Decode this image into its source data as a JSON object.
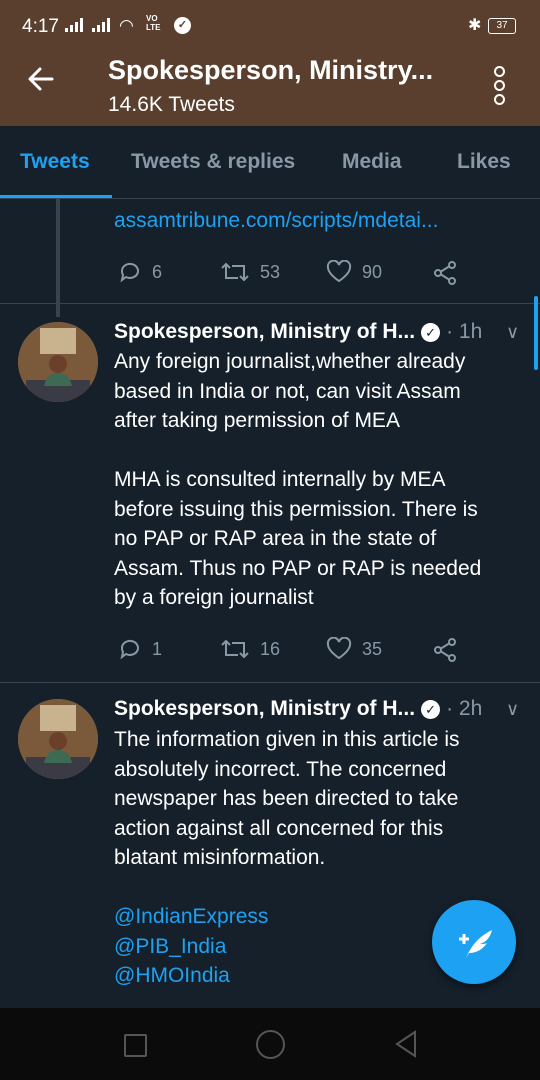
{
  "status_bar": {
    "time": "4:17",
    "volte": "VO\nLTE",
    "battery": "37",
    "bluetooth_icon": "bluetooth-icon",
    "wifi_icon": "wifi-icon"
  },
  "header": {
    "title": "Spokesperson, Ministry...",
    "subtitle": "14.6K Tweets",
    "back_icon": "arrow-left-icon",
    "more_icon": "more-vertical-icon"
  },
  "tabs": [
    {
      "label": "Tweets",
      "active": true
    },
    {
      "label": "Tweets & replies",
      "active": false
    },
    {
      "label": "Media",
      "active": false
    },
    {
      "label": "Likes",
      "active": false
    }
  ],
  "tweets": [
    {
      "link": "assamtribune.com/scripts/mdetai...",
      "replies": "6",
      "retweets": "53",
      "likes": "90"
    },
    {
      "name": "Spokesperson, Ministry of H...",
      "time": "· 1h",
      "paragraph1": [
        "Any foreign journalist,whether already",
        "based in India or not, can visit Assam",
        "after taking permission of MEA"
      ],
      "paragraph2": [
        "MHA is consulted internally by MEA",
        "before issuing this permission. There is",
        "no PAP or RAP area in the state of",
        "Assam. Thus no PAP or RAP is needed",
        "by a foreign journalist"
      ],
      "replies": "1",
      "retweets": "16",
      "likes": "35"
    },
    {
      "name": "Spokesperson, Ministry of H...",
      "time": "· 2h",
      "paragraph1": [
        "The information given in this article is",
        "absolutely incorrect. The concerned",
        "newspaper has been directed to take",
        "action against all concerned for this",
        "blatant misinformation."
      ],
      "mentions": [
        "@IndianExpress",
        "@PIB_India",
        "@HMOIndia"
      ]
    }
  ],
  "colors": {
    "accent": "#1da1f2",
    "background": "#15202b",
    "header": "#5a3f2e",
    "muted": "#8899a6"
  }
}
